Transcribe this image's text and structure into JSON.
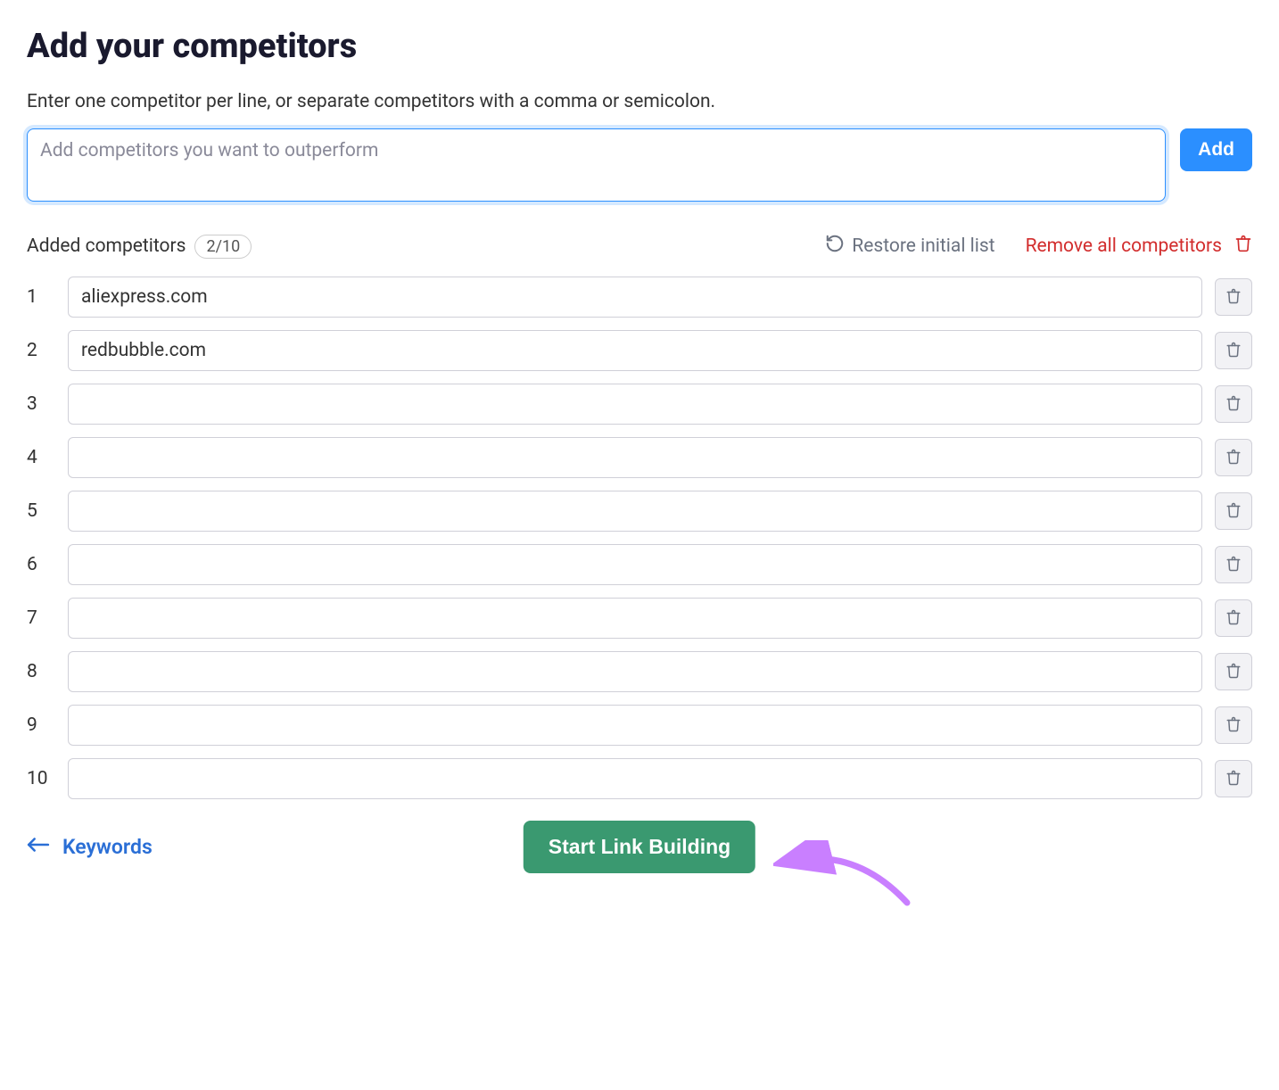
{
  "title": "Add your competitors",
  "instructions": "Enter one competitor per line, or separate competitors with a comma or semicolon.",
  "input": {
    "placeholder": "Add competitors you want to outperform",
    "add_button": "Add"
  },
  "list_header": {
    "label": "Added competitors",
    "count": "2/10",
    "restore_label": "Restore initial list",
    "remove_all_label": "Remove all competitors"
  },
  "competitors": [
    {
      "num": "1",
      "value": "aliexpress.com"
    },
    {
      "num": "2",
      "value": "redbubble.com"
    },
    {
      "num": "3",
      "value": ""
    },
    {
      "num": "4",
      "value": ""
    },
    {
      "num": "5",
      "value": ""
    },
    {
      "num": "6",
      "value": ""
    },
    {
      "num": "7",
      "value": ""
    },
    {
      "num": "8",
      "value": ""
    },
    {
      "num": "9",
      "value": ""
    },
    {
      "num": "10",
      "value": ""
    }
  ],
  "footer": {
    "keywords_label": "Keywords",
    "start_button": "Start Link Building"
  },
  "colors": {
    "primary_blue": "#2b8fff",
    "link_blue": "#2b6fd6",
    "danger_red": "#d22d2d",
    "success_green": "#3a9970",
    "annotation_purple": "#c97fff"
  }
}
